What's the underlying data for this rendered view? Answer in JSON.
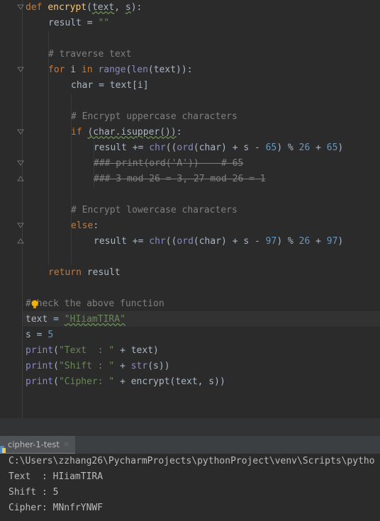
{
  "editor": {
    "lines": {
      "l1_kw": "def",
      "l1_fn": "encrypt",
      "l1_rest_a": "(",
      "l1_param1": "text",
      "l1_comma": ", ",
      "l1_param2": "s",
      "l1_rest_b": "):",
      "l2_a": "result = ",
      "l2_str": "\"\"",
      "l4_cm": "# traverse text",
      "l5_kw1": "for",
      "l5_a": " i ",
      "l5_kw2": "in",
      "l5_sp": " ",
      "l5_bi1": "range",
      "l5_b": "(",
      "l5_bi2": "len",
      "l5_c": "(text)):",
      "l6": "char = text[i]",
      "l8_cm": "# Encrypt uppercase characters",
      "l9_kw": "if",
      "l9_sp": " ",
      "l9_cond": "(char.isupper())",
      "l9_end": ":",
      "l10_a": "result += ",
      "l10_bi1": "chr",
      "l10_b": "((",
      "l10_bi2": "ord",
      "l10_c": "(char) + s - ",
      "l10_n1": "65",
      "l10_d": ") % ",
      "l10_n2": "26",
      "l10_e": " + ",
      "l10_n3": "65",
      "l10_f": ")",
      "l11_cm": "### print(ord('A'))    # 65",
      "l12_cm": "### 3 mod 26 = 3, 27 mod 26 = 1",
      "l14_cm": "# Encrypt lowercase characters",
      "l15_kw": "else",
      "l15_end": ":",
      "l16_a": "result += ",
      "l16_bi1": "chr",
      "l16_b": "((",
      "l16_bi2": "ord",
      "l16_c": "(char) + s - ",
      "l16_n1": "97",
      "l16_d": ") % ",
      "l16_n2": "26",
      "l16_e": " + ",
      "l16_n3": "97",
      "l16_f": ")",
      "l18_kw": "return",
      "l18_a": " result",
      "l20_cm_a": "#",
      "l20_cm_b": "check the above function",
      "l21_a": "text = ",
      "l21_str": "\"HIiamTIRA\"",
      "l22_a": "s = ",
      "l22_n": "5",
      "l23_bi": "print",
      "l23_a": "(",
      "l23_str": "\"Text  : \"",
      "l23_b": " + text)",
      "l24_bi": "print",
      "l24_a": "(",
      "l24_str": "\"Shift : \"",
      "l24_b": " + ",
      "l24_bi2": "str",
      "l24_c": "(s))",
      "l25_bi": "print",
      "l25_a": "(",
      "l25_str": "\"Cipher: \"",
      "l25_b": " + encrypt(text, s))"
    }
  },
  "run_panel": {
    "tab_label": "cipher-1-test",
    "tab_close": "×",
    "output": [
      "C:\\Users\\zzhang26\\PycharmProjects\\pythonProject\\venv\\Scripts\\pytho",
      "Text  : HIiamTIRA",
      "Shift : 5",
      "Cipher: MNnfrYNWF"
    ]
  },
  "colors": {
    "background": "#2b2b2b",
    "keyword": "#cc7832",
    "function": "#ffc66d",
    "builtin": "#8888c6",
    "string": "#6a8759",
    "number": "#6897bb",
    "comment": "#808080",
    "text": "#a9b7c6",
    "tab_accent": "#4a88c7"
  },
  "icons": [
    "fold-arrow-icon",
    "fold-end-icon",
    "intention-bulb-icon",
    "python-file-icon",
    "close-icon"
  ]
}
